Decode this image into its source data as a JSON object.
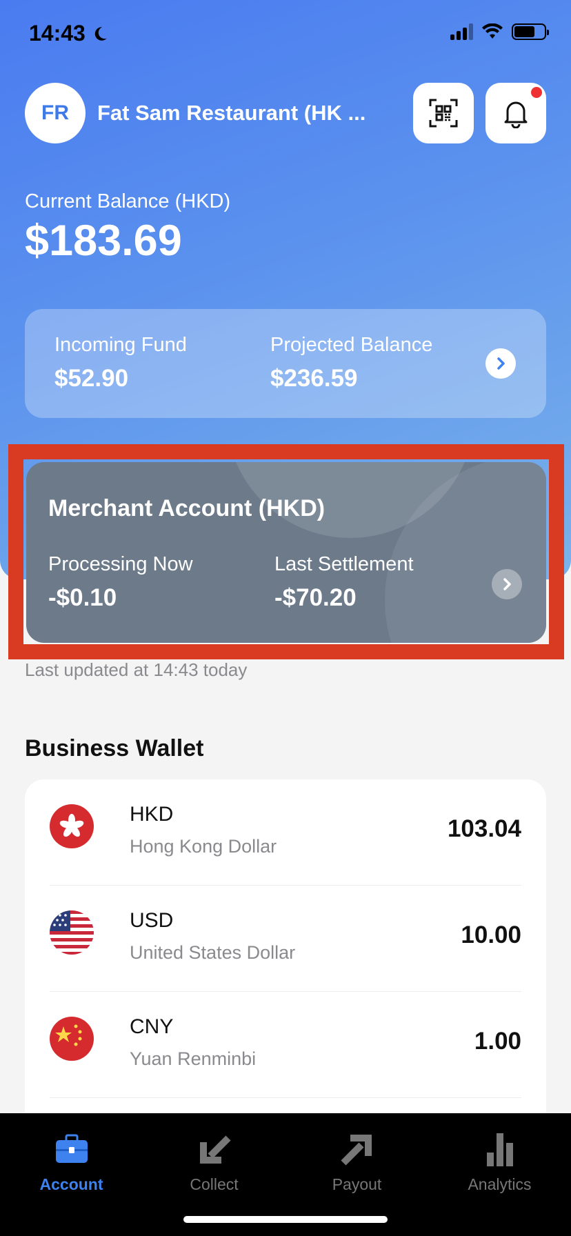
{
  "status_bar": {
    "time": "14:43"
  },
  "header": {
    "avatar_initials": "FR",
    "merchant_name": "Fat Sam Restaurant (HK ..."
  },
  "balance": {
    "label": "Current Balance (HKD)",
    "value": "$183.69"
  },
  "fund_card": {
    "incoming_label": "Incoming Fund",
    "incoming_value": "$52.90",
    "projected_label": "Projected Balance",
    "projected_value": "$236.59"
  },
  "merchant_account": {
    "title": "Merchant Account (HKD)",
    "processing_label": "Processing Now",
    "processing_value": "-$0.10",
    "settlement_label": "Last Settlement",
    "settlement_value": "-$70.20"
  },
  "last_updated": "Last updated at 14:43 today",
  "business_wallet": {
    "title": "Business Wallet",
    "items": [
      {
        "code": "HKD",
        "name": "Hong Kong Dollar",
        "amount": "103.04",
        "flag": "hk-flag-icon"
      },
      {
        "code": "USD",
        "name": "United States Dollar",
        "amount": "10.00",
        "flag": "us-flag-icon"
      },
      {
        "code": "CNY",
        "name": "Yuan Renminbi",
        "amount": "1.00",
        "flag": "cn-flag-icon"
      }
    ]
  },
  "tabbar": {
    "tabs": [
      {
        "label": "Account",
        "icon": "briefcase-icon",
        "active": true
      },
      {
        "label": "Collect",
        "icon": "arrow-down-left-icon",
        "active": false
      },
      {
        "label": "Payout",
        "icon": "arrow-up-right-icon",
        "active": false
      },
      {
        "label": "Analytics",
        "icon": "bar-chart-icon",
        "active": false
      }
    ]
  },
  "colors": {
    "accent": "#3d82ee",
    "highlight_border": "#d83a22",
    "merchant_card": "#6c7a8a",
    "notification": "#ee3033"
  }
}
